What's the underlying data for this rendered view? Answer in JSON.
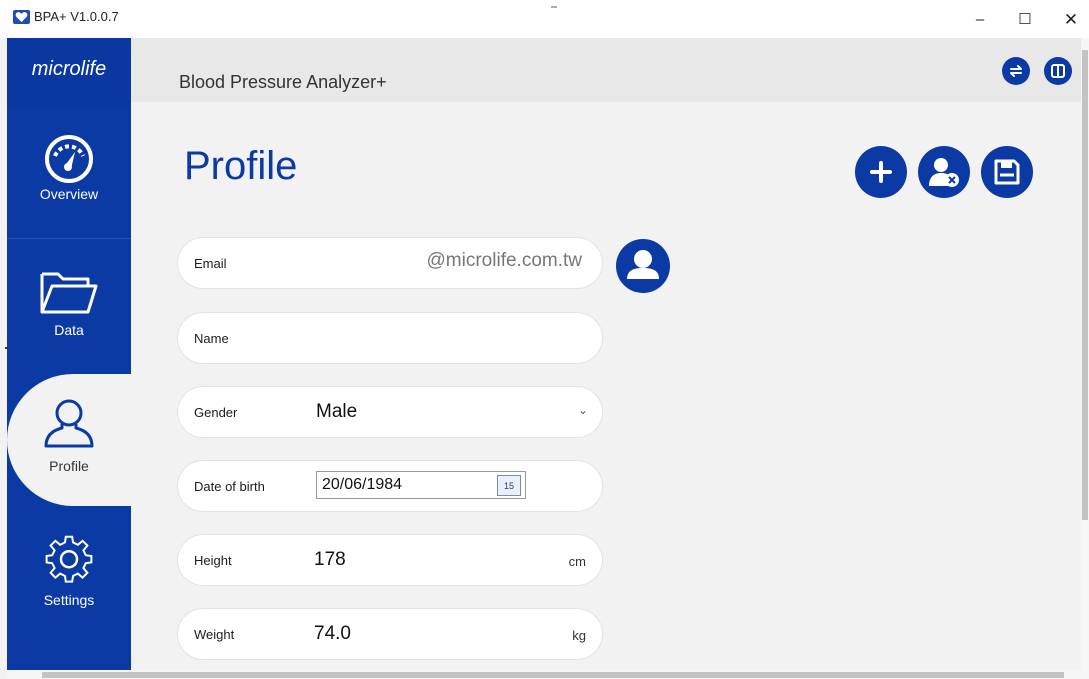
{
  "window": {
    "title": "BPA+ V1.0.0.7",
    "minimize": "–",
    "maximize": "☐",
    "close": "✕"
  },
  "sidebar": {
    "logo": "microlife",
    "items": [
      {
        "label": "Overview",
        "icon": "gauge-icon"
      },
      {
        "label": "Data",
        "icon": "folder-icon"
      },
      {
        "label": "Profile",
        "icon": "user-outline-icon",
        "active": true
      },
      {
        "label": "Settings",
        "icon": "gear-icon"
      }
    ]
  },
  "header": {
    "title": "Blood Pressure Analyzer+",
    "icons": [
      "swap-icon",
      "book-icon"
    ]
  },
  "main": {
    "title": "Profile",
    "actions": [
      "add-icon",
      "delete-user-icon",
      "save-icon"
    ],
    "fields": {
      "email": {
        "label": "Email",
        "value": "@microlife.com.tw"
      },
      "name": {
        "label": "Name",
        "value": ""
      },
      "gender": {
        "label": "Gender",
        "value": "Male"
      },
      "dob": {
        "label": "Date of birth",
        "value": "20/06/1984",
        "calendar_day": "15"
      },
      "height": {
        "label": "Height",
        "value": "178",
        "unit": "cm"
      },
      "weight": {
        "label": "Weight",
        "value": "74.0",
        "unit": "kg"
      }
    }
  },
  "colors": {
    "brand": "#0b3aa4",
    "background": "#f2f2f2"
  }
}
